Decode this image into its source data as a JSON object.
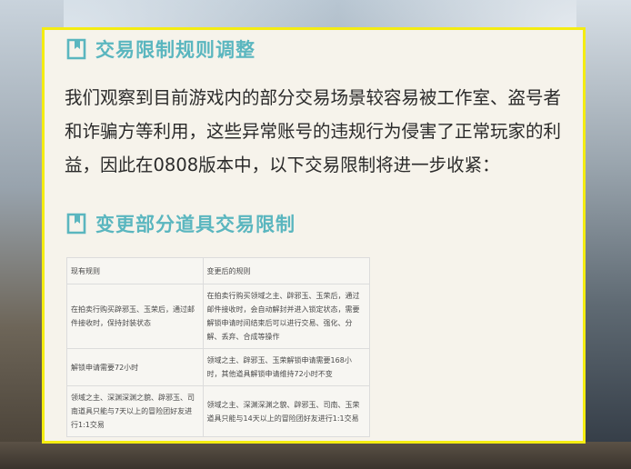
{
  "headings": {
    "trade_rules": "交易限制规则调整",
    "item_rules": "变更部分道具交易限制"
  },
  "intro_text": "我们观察到目前游戏内的部分交易场景较容易被工作室、盗号者和诈骗方等利用，这些异常账号的违规行为侵害了正常玩家的利益，因此在0808版本中，以下交易限制将进一步收紧：",
  "table": {
    "headers": [
      "现有规则",
      "变更后的规则"
    ],
    "rows": [
      {
        "current": "在拍卖行购买辟邪玉、玉荣后，通过邮件接收时，保持封装状态",
        "changed": "在拍卖行购买领域之主、辟邪玉、玉荣后，通过邮件接收时，会自动解封并进入锁定状态，需要解锁申请时间结束后可以进行交易、强化、分解、丢弃、合成等操作"
      },
      {
        "current": "解锁申请需要72小时",
        "changed": "领域之主、辟邪玉、玉荣解锁申请需要168小时，其他道具解锁申请维持72小时不变"
      },
      {
        "current": "领域之主、深渊深渊之貌、辟邪玉、司南道具只能与7天以上的冒险团好友进行1:1交易",
        "changed": "领域之主、深渊深渊之貌、辟邪玉、司南、玉荣道具只能与14天以上的冒险团好友进行1:1交易"
      }
    ]
  },
  "colors": {
    "heading": "#5ab6bf",
    "card_border": "#f4ec12",
    "card_bg": "#f6f3eb"
  },
  "icons": {
    "heading": "bookmark-icon"
  }
}
